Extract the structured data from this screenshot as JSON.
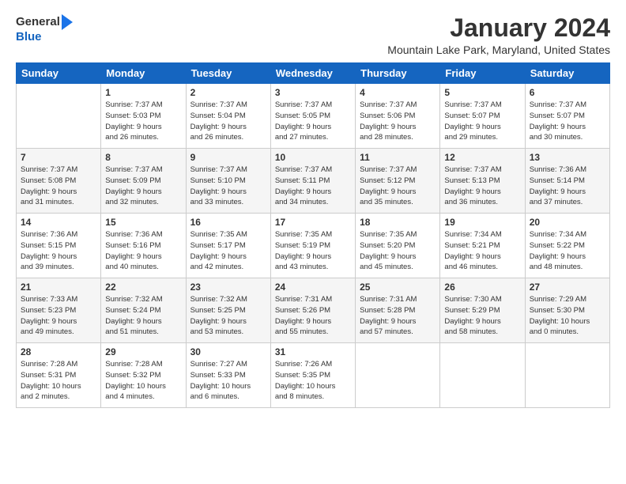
{
  "logo": {
    "line1": "General",
    "line2": "Blue"
  },
  "title": "January 2024",
  "location": "Mountain Lake Park, Maryland, United States",
  "days_of_week": [
    "Sunday",
    "Monday",
    "Tuesday",
    "Wednesday",
    "Thursday",
    "Friday",
    "Saturday"
  ],
  "weeks": [
    [
      {
        "day": "",
        "info": ""
      },
      {
        "day": "1",
        "info": "Sunrise: 7:37 AM\nSunset: 5:03 PM\nDaylight: 9 hours\nand 26 minutes."
      },
      {
        "day": "2",
        "info": "Sunrise: 7:37 AM\nSunset: 5:04 PM\nDaylight: 9 hours\nand 26 minutes."
      },
      {
        "day": "3",
        "info": "Sunrise: 7:37 AM\nSunset: 5:05 PM\nDaylight: 9 hours\nand 27 minutes."
      },
      {
        "day": "4",
        "info": "Sunrise: 7:37 AM\nSunset: 5:06 PM\nDaylight: 9 hours\nand 28 minutes."
      },
      {
        "day": "5",
        "info": "Sunrise: 7:37 AM\nSunset: 5:07 PM\nDaylight: 9 hours\nand 29 minutes."
      },
      {
        "day": "6",
        "info": "Sunrise: 7:37 AM\nSunset: 5:07 PM\nDaylight: 9 hours\nand 30 minutes."
      }
    ],
    [
      {
        "day": "7",
        "info": "Sunrise: 7:37 AM\nSunset: 5:08 PM\nDaylight: 9 hours\nand 31 minutes."
      },
      {
        "day": "8",
        "info": "Sunrise: 7:37 AM\nSunset: 5:09 PM\nDaylight: 9 hours\nand 32 minutes."
      },
      {
        "day": "9",
        "info": "Sunrise: 7:37 AM\nSunset: 5:10 PM\nDaylight: 9 hours\nand 33 minutes."
      },
      {
        "day": "10",
        "info": "Sunrise: 7:37 AM\nSunset: 5:11 PM\nDaylight: 9 hours\nand 34 minutes."
      },
      {
        "day": "11",
        "info": "Sunrise: 7:37 AM\nSunset: 5:12 PM\nDaylight: 9 hours\nand 35 minutes."
      },
      {
        "day": "12",
        "info": "Sunrise: 7:37 AM\nSunset: 5:13 PM\nDaylight: 9 hours\nand 36 minutes."
      },
      {
        "day": "13",
        "info": "Sunrise: 7:36 AM\nSunset: 5:14 PM\nDaylight: 9 hours\nand 37 minutes."
      }
    ],
    [
      {
        "day": "14",
        "info": "Sunrise: 7:36 AM\nSunset: 5:15 PM\nDaylight: 9 hours\nand 39 minutes."
      },
      {
        "day": "15",
        "info": "Sunrise: 7:36 AM\nSunset: 5:16 PM\nDaylight: 9 hours\nand 40 minutes."
      },
      {
        "day": "16",
        "info": "Sunrise: 7:35 AM\nSunset: 5:17 PM\nDaylight: 9 hours\nand 42 minutes."
      },
      {
        "day": "17",
        "info": "Sunrise: 7:35 AM\nSunset: 5:19 PM\nDaylight: 9 hours\nand 43 minutes."
      },
      {
        "day": "18",
        "info": "Sunrise: 7:35 AM\nSunset: 5:20 PM\nDaylight: 9 hours\nand 45 minutes."
      },
      {
        "day": "19",
        "info": "Sunrise: 7:34 AM\nSunset: 5:21 PM\nDaylight: 9 hours\nand 46 minutes."
      },
      {
        "day": "20",
        "info": "Sunrise: 7:34 AM\nSunset: 5:22 PM\nDaylight: 9 hours\nand 48 minutes."
      }
    ],
    [
      {
        "day": "21",
        "info": "Sunrise: 7:33 AM\nSunset: 5:23 PM\nDaylight: 9 hours\nand 49 minutes."
      },
      {
        "day": "22",
        "info": "Sunrise: 7:32 AM\nSunset: 5:24 PM\nDaylight: 9 hours\nand 51 minutes."
      },
      {
        "day": "23",
        "info": "Sunrise: 7:32 AM\nSunset: 5:25 PM\nDaylight: 9 hours\nand 53 minutes."
      },
      {
        "day": "24",
        "info": "Sunrise: 7:31 AM\nSunset: 5:26 PM\nDaylight: 9 hours\nand 55 minutes."
      },
      {
        "day": "25",
        "info": "Sunrise: 7:31 AM\nSunset: 5:28 PM\nDaylight: 9 hours\nand 57 minutes."
      },
      {
        "day": "26",
        "info": "Sunrise: 7:30 AM\nSunset: 5:29 PM\nDaylight: 9 hours\nand 58 minutes."
      },
      {
        "day": "27",
        "info": "Sunrise: 7:29 AM\nSunset: 5:30 PM\nDaylight: 10 hours\nand 0 minutes."
      }
    ],
    [
      {
        "day": "28",
        "info": "Sunrise: 7:28 AM\nSunset: 5:31 PM\nDaylight: 10 hours\nand 2 minutes."
      },
      {
        "day": "29",
        "info": "Sunrise: 7:28 AM\nSunset: 5:32 PM\nDaylight: 10 hours\nand 4 minutes."
      },
      {
        "day": "30",
        "info": "Sunrise: 7:27 AM\nSunset: 5:33 PM\nDaylight: 10 hours\nand 6 minutes."
      },
      {
        "day": "31",
        "info": "Sunrise: 7:26 AM\nSunset: 5:35 PM\nDaylight: 10 hours\nand 8 minutes."
      },
      {
        "day": "",
        "info": ""
      },
      {
        "day": "",
        "info": ""
      },
      {
        "day": "",
        "info": ""
      }
    ]
  ]
}
